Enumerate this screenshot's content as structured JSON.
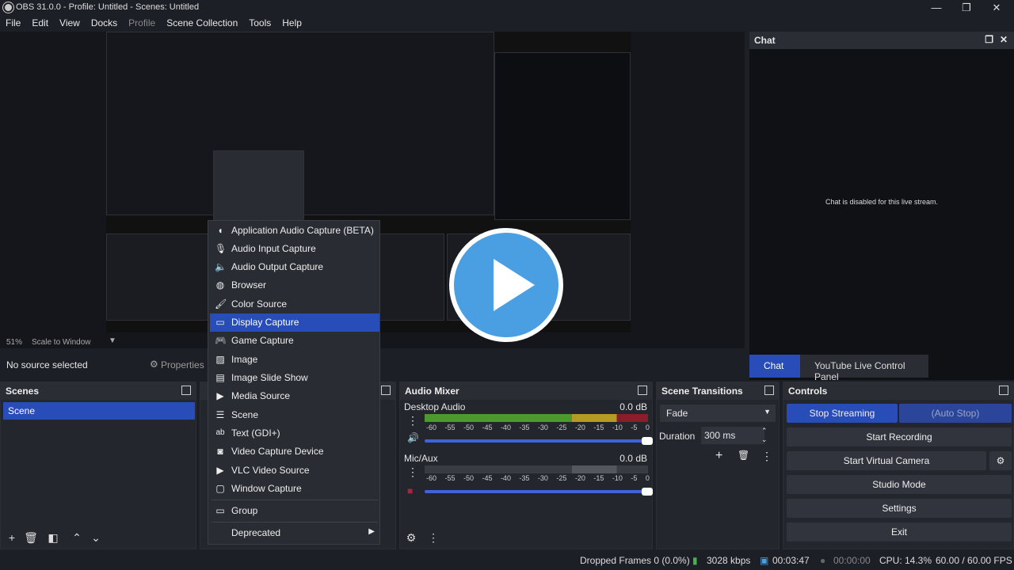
{
  "window": {
    "title": "OBS 31.0.0 - Profile: Untitled - Scenes: Untitled",
    "minimize": "—",
    "maximize": "❐",
    "close": "✕"
  },
  "menubar": [
    "File",
    "Edit",
    "View",
    "Docks",
    "Profile",
    "Scene Collection",
    "Tools",
    "Help"
  ],
  "preview": {
    "zoom": "51%",
    "scale_mode": "Scale to Window"
  },
  "source_bar": {
    "no_source": "No source selected",
    "properties": "Properties"
  },
  "chat": {
    "title": "Chat",
    "message": "Chat is disabled for this live stream.",
    "tabs": [
      "Chat",
      "YouTube Live Control Panel"
    ]
  },
  "scenes": {
    "title": "Scenes",
    "items": [
      "Scene"
    ]
  },
  "mixer": {
    "title": "Audio Mixer",
    "channels": [
      {
        "name": "Desktop Audio",
        "db": "0.0 dB"
      },
      {
        "name": "Mic/Aux",
        "db": "0.0 dB"
      }
    ],
    "ticks": [
      "-60",
      "-55",
      "-50",
      "-45",
      "-40",
      "-35",
      "-30",
      "-25",
      "-20",
      "-15",
      "-10",
      "-5",
      "0"
    ]
  },
  "transitions": {
    "title": "Scene Transitions",
    "selected": "Fade",
    "duration_label": "Duration",
    "duration_value": "300 ms"
  },
  "controls": {
    "title": "Controls",
    "stop_streaming": "Stop Streaming",
    "auto_stop": "(Auto Stop)",
    "start_recording": "Start Recording",
    "start_virtual_camera": "Start Virtual Camera",
    "studio_mode": "Studio Mode",
    "settings": "Settings",
    "exit": "Exit"
  },
  "add_source_menu": {
    "items": [
      {
        "label": "Application Audio Capture (BETA)",
        "icon": "speaker-icon"
      },
      {
        "label": "Audio Input Capture",
        "icon": "microphone-icon"
      },
      {
        "label": "Audio Output Capture",
        "icon": "speaker-icon"
      },
      {
        "label": "Browser",
        "icon": "globe-icon"
      },
      {
        "label": "Color Source",
        "icon": "paintbrush-icon"
      },
      {
        "label": "Display Capture",
        "icon": "monitor-icon"
      },
      {
        "label": "Game Capture",
        "icon": "gamepad-icon"
      },
      {
        "label": "Image",
        "icon": "image-icon"
      },
      {
        "label": "Image Slide Show",
        "icon": "slideshow-icon"
      },
      {
        "label": "Media Source",
        "icon": "play-icon"
      },
      {
        "label": "Scene",
        "icon": "list-icon"
      },
      {
        "label": "Text (GDI+)",
        "icon": "text-icon"
      },
      {
        "label": "Video Capture Device",
        "icon": "camera-icon"
      },
      {
        "label": "VLC Video Source",
        "icon": "play-icon"
      },
      {
        "label": "Window Capture",
        "icon": "window-icon"
      }
    ],
    "group": "Group",
    "deprecated": "Deprecated",
    "selected": "Display Capture"
  },
  "status": {
    "dropped": "Dropped Frames 0 (0.0%)",
    "bitrate": "3028 kbps",
    "stream_time": "00:03:47",
    "rec_time": "00:00:00",
    "cpu": "CPU: 14.3%",
    "fps": "60.00 / 60.00 FPS"
  },
  "colors": {
    "accent": "#284cb8",
    "panel": "#24262d",
    "play": "#4a9fe2"
  }
}
